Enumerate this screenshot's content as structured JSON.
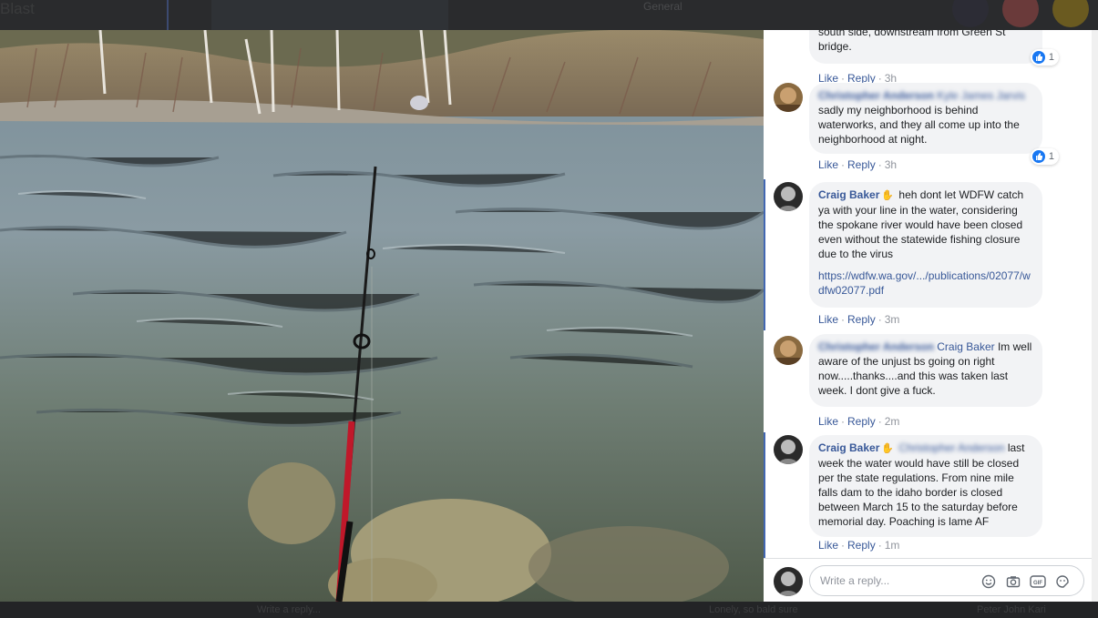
{
  "background": {
    "title": "Blast",
    "group_tag": "General"
  },
  "photo": {
    "description_icon": "fishing-rod-river-photo"
  },
  "comments": [
    {
      "id": "c0",
      "author": "",
      "text": "south side, downstream from Green St bridge.",
      "reactions": "1",
      "actions": {
        "like": "Like",
        "reply": "Reply",
        "time": "3h"
      }
    },
    {
      "id": "c1",
      "author": "Christopher Anderson",
      "mentions": "Kyle James Jarvis",
      "text": "sadly my neighborhood is behind waterworks, and they all come up into the neighborhood at night.",
      "reactions": "1",
      "actions": {
        "like": "Like",
        "reply": "Reply",
        "time": "3h"
      }
    },
    {
      "id": "c2",
      "author": "Craig Baker",
      "text": "heh dont let WDFW catch ya with your line in the water, considering the spokane river would have been closed even without the statewide fishing closure due to the virus",
      "link": "https://wdfw.wa.gov/.../publications/02077/wdfw02077.pdf",
      "actions": {
        "like": "Like",
        "reply": "Reply",
        "time": "3m"
      }
    },
    {
      "id": "c3",
      "author": "Christopher Anderson",
      "mention": "Craig Baker",
      "text": "Im well aware of the unjust bs going on right now.....thanks....and this was taken last week. I dont give a fuck.",
      "actions": {
        "like": "Like",
        "reply": "Reply",
        "time": "2m"
      }
    },
    {
      "id": "c4",
      "author": "Craig Baker",
      "mention": "Christopher Anderson",
      "text": "last week the water would have still be closed per the state regulations. From nine mile falls dam to the idaho border is closed between March 15 to the saturday before memorial day. Poaching is lame AF",
      "actions": {
        "like": "Like",
        "reply": "Reply",
        "time": "1m"
      }
    }
  ],
  "reply_box": {
    "placeholder": "Write a reply...",
    "icons": [
      "emoji-icon",
      "camera-icon",
      "gif-icon",
      "sticker-icon"
    ]
  },
  "bottom_bar": {
    "left_text": "Write a reply...",
    "middle_text": "Lonely, so bald sure",
    "right_text": "Peter John Kari"
  },
  "colors": {
    "link": "#385898",
    "bubble": "#f2f3f5",
    "like_blue": "#1877f2",
    "highlight": "#4267b2"
  }
}
